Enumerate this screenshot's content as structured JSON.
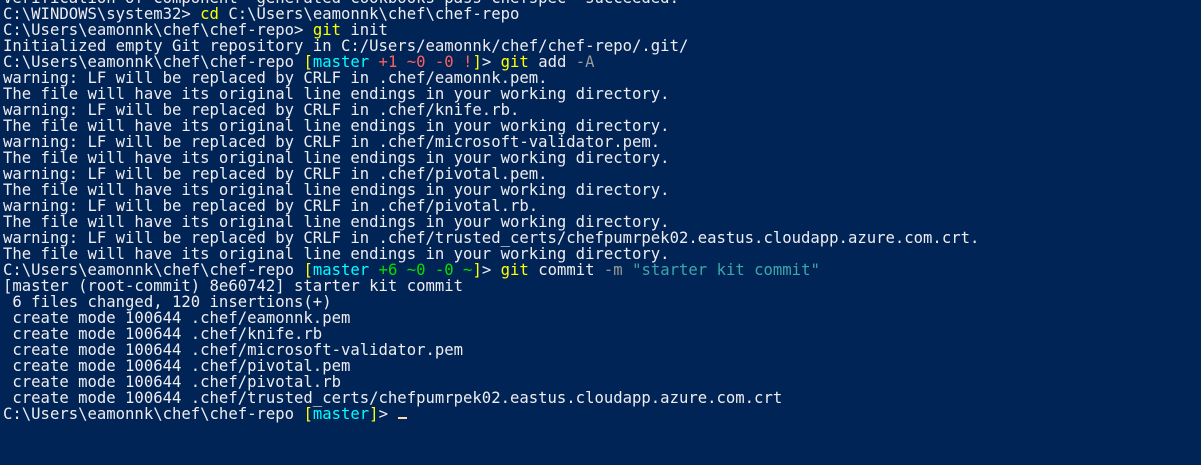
{
  "terminal": {
    "lines": [
      [
        {
          "t": "Verification of component 'generated cookbooks pass chefspec' succeeded.",
          "c": "white"
        }
      ],
      [
        {
          "t": "C:\\WINDOWS\\system32> ",
          "c": "white"
        },
        {
          "t": "cd ",
          "c": "yellow"
        },
        {
          "t": "C:\\Users\\eamonnk\\chef\\chef-repo",
          "c": "white"
        }
      ],
      [
        {
          "t": "C:\\Users\\eamonnk\\chef\\chef-repo> ",
          "c": "white"
        },
        {
          "t": "git ",
          "c": "yellow"
        },
        {
          "t": "init",
          "c": "white"
        }
      ],
      [
        {
          "t": "Initialized empty Git repository in C:/Users/eamonnk/chef/chef-repo/.git/",
          "c": "white"
        }
      ],
      [
        {
          "t": "C:\\Users\\eamonnk\\chef\\chef-repo ",
          "c": "white"
        },
        {
          "t": "[",
          "c": "yellow"
        },
        {
          "t": "master",
          "c": "cyan"
        },
        {
          "t": " +1 ~0 -0 !",
          "c": "red"
        },
        {
          "t": "]",
          "c": "yellow"
        },
        {
          "t": "> ",
          "c": "white"
        },
        {
          "t": "git ",
          "c": "yellow"
        },
        {
          "t": "add ",
          "c": "white"
        },
        {
          "t": "-A",
          "c": "gray"
        }
      ],
      [
        {
          "t": "warning: LF will be replaced by CRLF in .chef/eamonnk.pem.",
          "c": "white"
        }
      ],
      [
        {
          "t": "The file will have its original line endings in your working directory.",
          "c": "white"
        }
      ],
      [
        {
          "t": "warning: LF will be replaced by CRLF in .chef/knife.rb.",
          "c": "white"
        }
      ],
      [
        {
          "t": "The file will have its original line endings in your working directory.",
          "c": "white"
        }
      ],
      [
        {
          "t": "warning: LF will be replaced by CRLF in .chef/microsoft-validator.pem.",
          "c": "white"
        }
      ],
      [
        {
          "t": "The file will have its original line endings in your working directory.",
          "c": "white"
        }
      ],
      [
        {
          "t": "warning: LF will be replaced by CRLF in .chef/pivotal.pem.",
          "c": "white"
        }
      ],
      [
        {
          "t": "The file will have its original line endings in your working directory.",
          "c": "white"
        }
      ],
      [
        {
          "t": "warning: LF will be replaced by CRLF in .chef/pivotal.rb.",
          "c": "white"
        }
      ],
      [
        {
          "t": "The file will have its original line endings in your working directory.",
          "c": "white"
        }
      ],
      [
        {
          "t": "warning: LF will be replaced by CRLF in .chef/trusted_certs/chefpumrpek02.eastus.cloudapp.azure.com.crt.",
          "c": "white"
        }
      ],
      [
        {
          "t": "The file will have its original line endings in your working directory.",
          "c": "white"
        }
      ],
      [
        {
          "t": "C:\\Users\\eamonnk\\chef\\chef-repo ",
          "c": "white"
        },
        {
          "t": "[",
          "c": "yellow"
        },
        {
          "t": "master",
          "c": "cyan"
        },
        {
          "t": " +6 ~0 -0 ~",
          "c": "green"
        },
        {
          "t": "]",
          "c": "yellow"
        },
        {
          "t": "> ",
          "c": "white"
        },
        {
          "t": "git ",
          "c": "yellow"
        },
        {
          "t": "commit ",
          "c": "white"
        },
        {
          "t": "-m ",
          "c": "gray"
        },
        {
          "t": "\"starter kit commit\"",
          "c": "darkcyan"
        }
      ],
      [
        {
          "t": "[master (root-commit) 8e60742] starter kit commit",
          "c": "white"
        }
      ],
      [
        {
          "t": " 6 files changed, 120 insertions(+)",
          "c": "white"
        }
      ],
      [
        {
          "t": " create mode 100644 .chef/eamonnk.pem",
          "c": "white"
        }
      ],
      [
        {
          "t": " create mode 100644 .chef/knife.rb",
          "c": "white"
        }
      ],
      [
        {
          "t": " create mode 100644 .chef/microsoft-validator.pem",
          "c": "white"
        }
      ],
      [
        {
          "t": " create mode 100644 .chef/pivotal.pem",
          "c": "white"
        }
      ],
      [
        {
          "t": " create mode 100644 .chef/pivotal.rb",
          "c": "white"
        }
      ],
      [
        {
          "t": " create mode 100644 .chef/trusted_certs/chefpumrpek02.eastus.cloudapp.azure.com.crt",
          "c": "white"
        }
      ],
      [
        {
          "t": "C:\\Users\\eamonnk\\chef\\chef-repo ",
          "c": "white"
        },
        {
          "t": "[",
          "c": "yellow"
        },
        {
          "t": "master",
          "c": "cyan"
        },
        {
          "t": "]",
          "c": "yellow"
        },
        {
          "t": "> ",
          "c": "white"
        }
      ]
    ],
    "colors": {
      "background": "#012456",
      "foreground": "#eeedf0",
      "command": "#ffff00",
      "branch": "#00ffff",
      "added": "#00e000",
      "untracked": "#ff5f5f",
      "parameter": "#9a9a9a",
      "string": "#3aa8a8",
      "cursor": "#fedba9"
    }
  }
}
